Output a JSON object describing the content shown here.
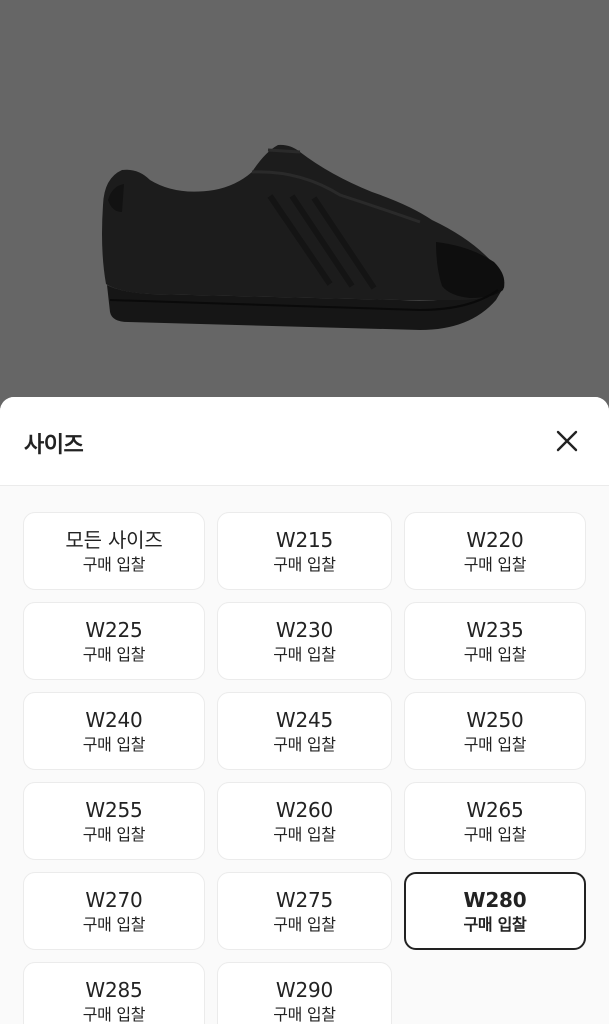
{
  "sheet": {
    "title": "사이즈",
    "close_icon": "close-icon"
  },
  "product": {
    "image_icon": "sneaker-image"
  },
  "sizes": [
    {
      "label": "모든 사이즈",
      "sub": "구매 입찰",
      "selected": false
    },
    {
      "label": "W215",
      "sub": "구매 입찰",
      "selected": false
    },
    {
      "label": "W220",
      "sub": "구매 입찰",
      "selected": false
    },
    {
      "label": "W225",
      "sub": "구매 입찰",
      "selected": false
    },
    {
      "label": "W230",
      "sub": "구매 입찰",
      "selected": false
    },
    {
      "label": "W235",
      "sub": "구매 입찰",
      "selected": false
    },
    {
      "label": "W240",
      "sub": "구매 입찰",
      "selected": false
    },
    {
      "label": "W245",
      "sub": "구매 입찰",
      "selected": false
    },
    {
      "label": "W250",
      "sub": "구매 입찰",
      "selected": false
    },
    {
      "label": "W255",
      "sub": "구매 입찰",
      "selected": false
    },
    {
      "label": "W260",
      "sub": "구매 입찰",
      "selected": false
    },
    {
      "label": "W265",
      "sub": "구매 입찰",
      "selected": false
    },
    {
      "label": "W270",
      "sub": "구매 입찰",
      "selected": false
    },
    {
      "label": "W275",
      "sub": "구매 입찰",
      "selected": false
    },
    {
      "label": "W280",
      "sub": "구매 입찰",
      "selected": true
    },
    {
      "label": "W285",
      "sub": "구매 입찰",
      "selected": false
    },
    {
      "label": "W290",
      "sub": "구매 입찰",
      "selected": false
    }
  ],
  "colors": {
    "overlay": "#666666",
    "text": "#222222",
    "border": "#ebebeb",
    "selected_border": "#222222"
  }
}
